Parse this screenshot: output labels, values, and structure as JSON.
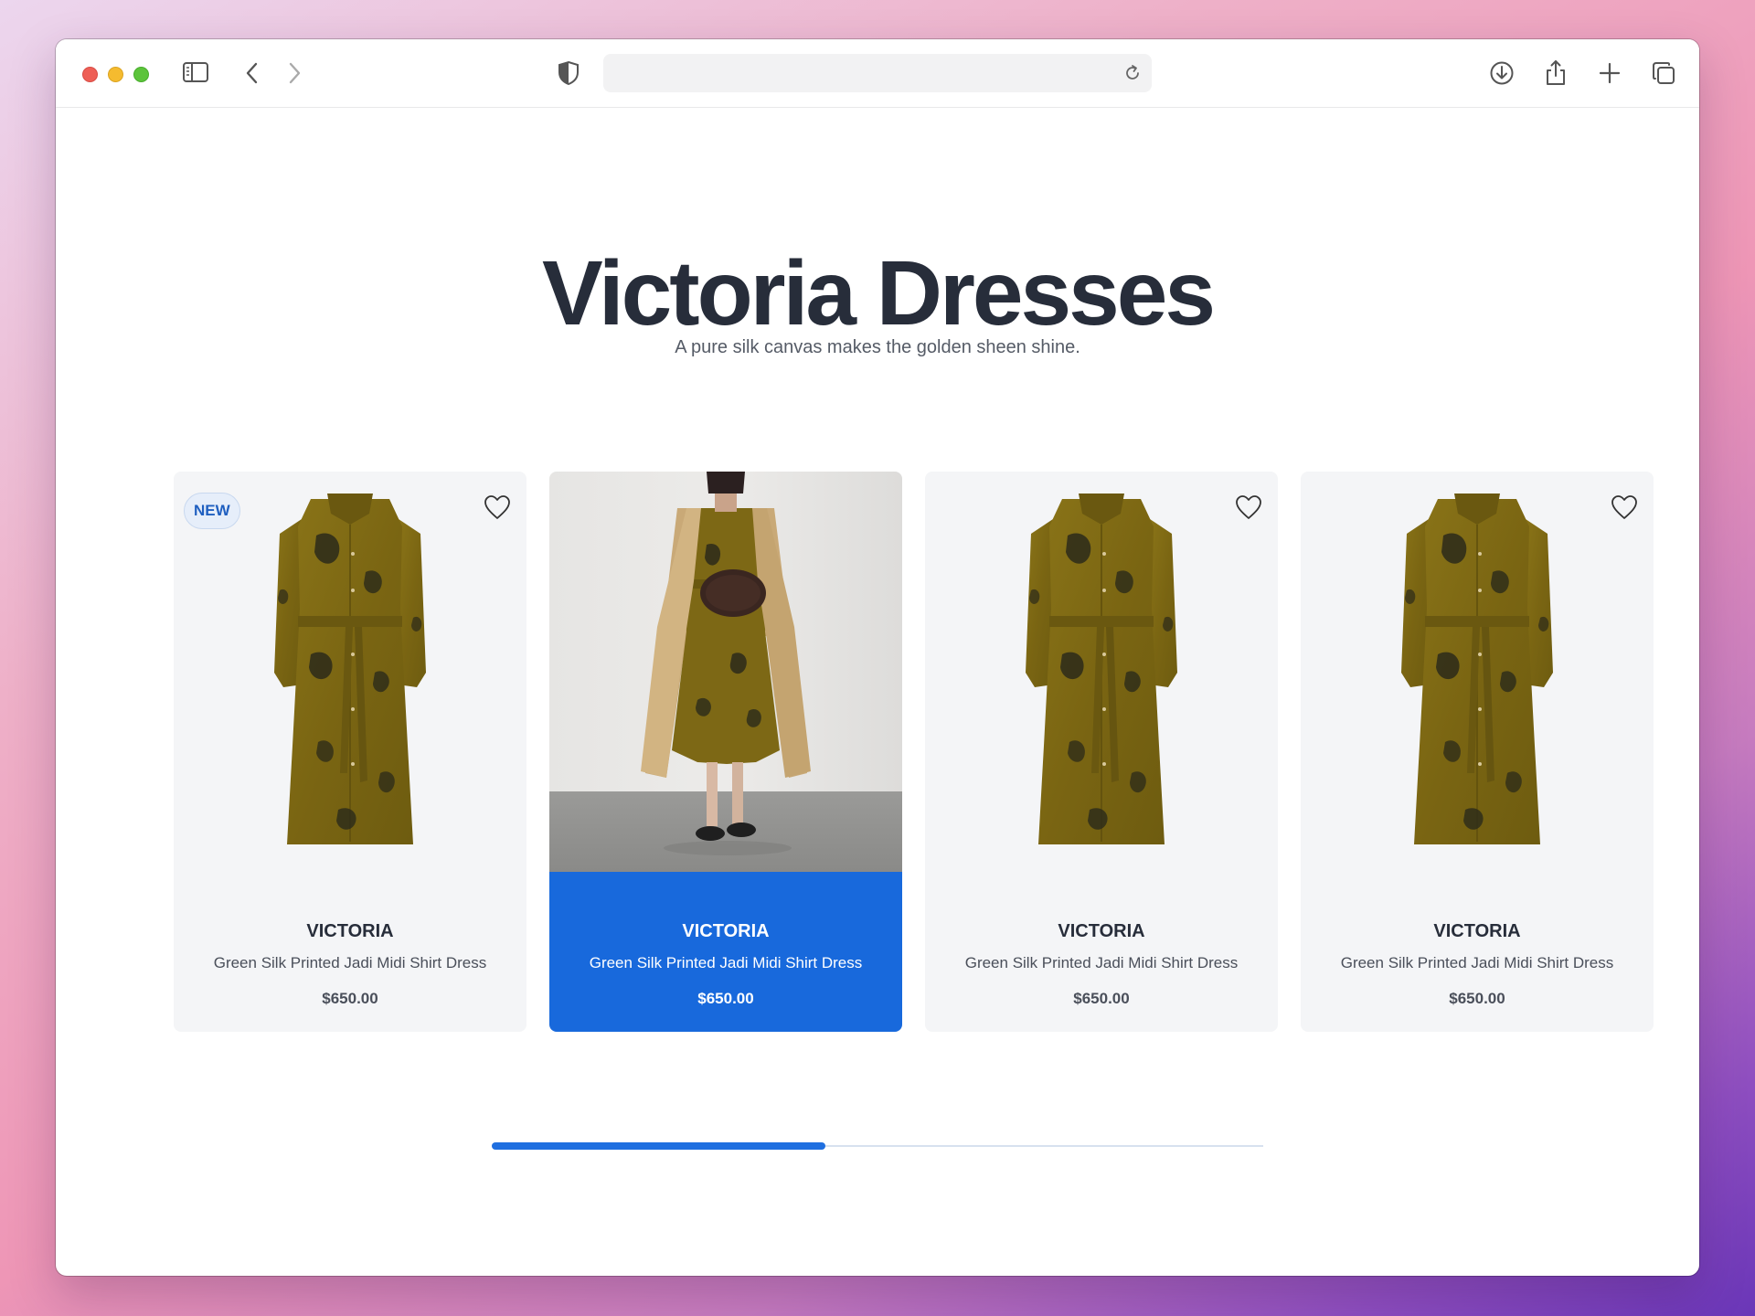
{
  "browser": {
    "url": "",
    "buttons": [
      "sidebar-toggle",
      "back",
      "forward",
      "download",
      "share",
      "new-tab",
      "tab-overview"
    ],
    "icons": {
      "sidebar": "sidebar-icon",
      "back": "chevron-left-icon",
      "forward": "chevron-right-icon",
      "shield": "shield-icon",
      "reload": "reload-icon",
      "download": "download-icon",
      "share": "share-icon",
      "plus": "plus-icon",
      "tabs": "tabs-icon"
    }
  },
  "hero": {
    "title": "Victoria Dresses",
    "subtitle": "A pure silk canvas makes the golden sheen shine."
  },
  "products": [
    {
      "badge": "NEW",
      "brand": "VICTORIA",
      "name": "Green Silk Printed Jadi Midi Shirt Dress",
      "price": "$650.00",
      "image": "dress-flat",
      "active": false
    },
    {
      "badge": "",
      "brand": "VICTORIA",
      "name": "Green Silk Printed Jadi Midi Shirt Dress",
      "price": "$650.00",
      "image": "dress-model",
      "active": true
    },
    {
      "badge": "",
      "brand": "VICTORIA",
      "name": "Green Silk Printed Jadi Midi Shirt Dress",
      "price": "$650.00",
      "image": "dress-flat",
      "active": false
    },
    {
      "badge": "",
      "brand": "VICTORIA",
      "name": "Green Silk Printed Jadi Midi Shirt Dress",
      "price": "$650.00",
      "image": "dress-flat",
      "active": false
    }
  ],
  "carousel": {
    "progress_fraction": 0.433
  },
  "colors": {
    "accent": "#1869dc",
    "title": "#272d3a",
    "card_bg": "#f4f5f7",
    "dress": "#7f6a14"
  }
}
